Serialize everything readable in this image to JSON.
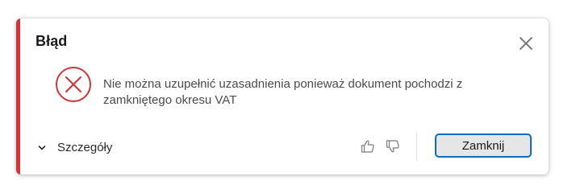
{
  "dialog": {
    "title": "Błąd",
    "message": "Nie można uzupełnić uzasadnienia ponieważ dokument pochodzi z zamkniętego okresu VAT",
    "details_label": "Szczegóły",
    "close_button_label": "Zamknij",
    "icons": {
      "close": "close-icon",
      "error": "error-icon",
      "expand": "chevron-down-icon",
      "like": "thumbs-up-icon",
      "dislike": "thumbs-down-icon"
    },
    "colors": {
      "accent": "#d13438",
      "error_icon": "#d13438",
      "button_border": "#0f6cbd",
      "button_fill": "#e6e6e6"
    }
  }
}
